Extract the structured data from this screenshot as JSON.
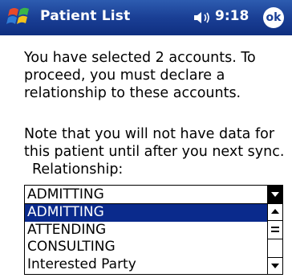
{
  "titlebar": {
    "title": "Patient List",
    "time": "9:18",
    "ok_label": "ok",
    "colors": {
      "bar": "#1a3f95",
      "text": "#ffffff"
    },
    "icons": [
      "windows-start-flag-icon",
      "speaker-icon"
    ]
  },
  "main": {
    "message": "You have selected 2 accounts.  To\nproceed, you must declare a\nrelationship to these accounts.",
    "note": "Note that you will not have data for\nthis patient until after you next sync.",
    "relationship_label": "Relationship:",
    "relationship": {
      "selected": "ADMITTING",
      "options": [
        "ADMITTING",
        "ATTENDING",
        "CONSULTING",
        "Interested Party"
      ],
      "highlight_color": "#0a2a8c"
    }
  }
}
